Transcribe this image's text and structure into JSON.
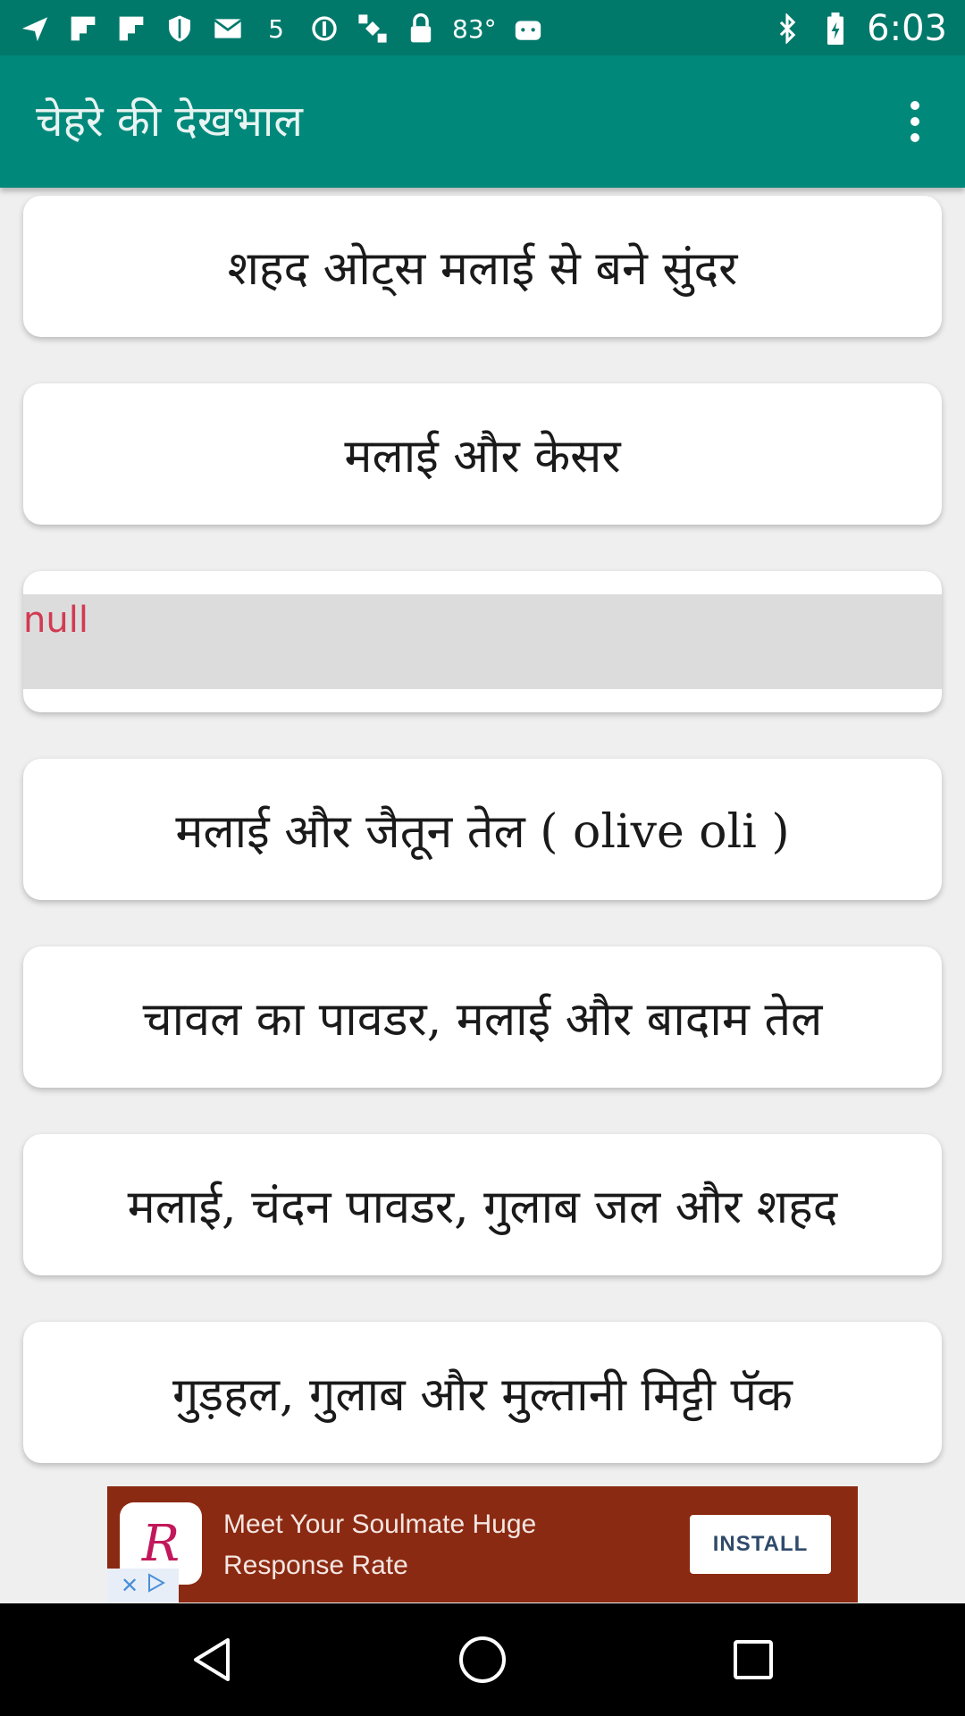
{
  "status_bar": {
    "time": "6:03",
    "temperature": "83°",
    "notification_count": "5",
    "icons": [
      "navigation-icon",
      "flipboard-icon",
      "flipboard-icon",
      "shield-icon",
      "mail-icon",
      "number-icon",
      "ring-icon",
      "satellite-icon",
      "lock-icon",
      "android-icon",
      "bluetooth-icon",
      "battery-icon"
    ]
  },
  "app_bar": {
    "title": "चेहरे की देखभाल",
    "menu_icon": "more-vert-icon"
  },
  "list": {
    "items": [
      {
        "label": "शहद ओट्स मलाई से बने सुंदर"
      },
      {
        "label": "मलाई और केसर"
      },
      {
        "label": "null"
      },
      {
        "label": "मलाई और जैतून तेल ( olive oli )"
      },
      {
        "label": "चावल का पावडर, मलाई और बादाम तेल"
      },
      {
        "label": "मलाई, चंदन पावडर, गुलाब जल और शहद"
      },
      {
        "label": "गुड़हल, गुलाब और मुल्तानी मिट्टी पॅक"
      }
    ]
  },
  "ad": {
    "logo_letter": "R",
    "line1": "Meet Your Soulmate Huge",
    "line2": "Response Rate",
    "install_label": "INSTALL",
    "adchoices_icons": [
      "close-icon",
      "play-icon"
    ]
  },
  "nav_bar": {
    "buttons": [
      "back-icon",
      "home-icon",
      "recents-icon"
    ]
  },
  "colors": {
    "app_bar": "#00897b",
    "status_bar": "#00796b",
    "background": "#efefef",
    "null_text": "#d23a52",
    "ad_background": "#8b2a12"
  }
}
